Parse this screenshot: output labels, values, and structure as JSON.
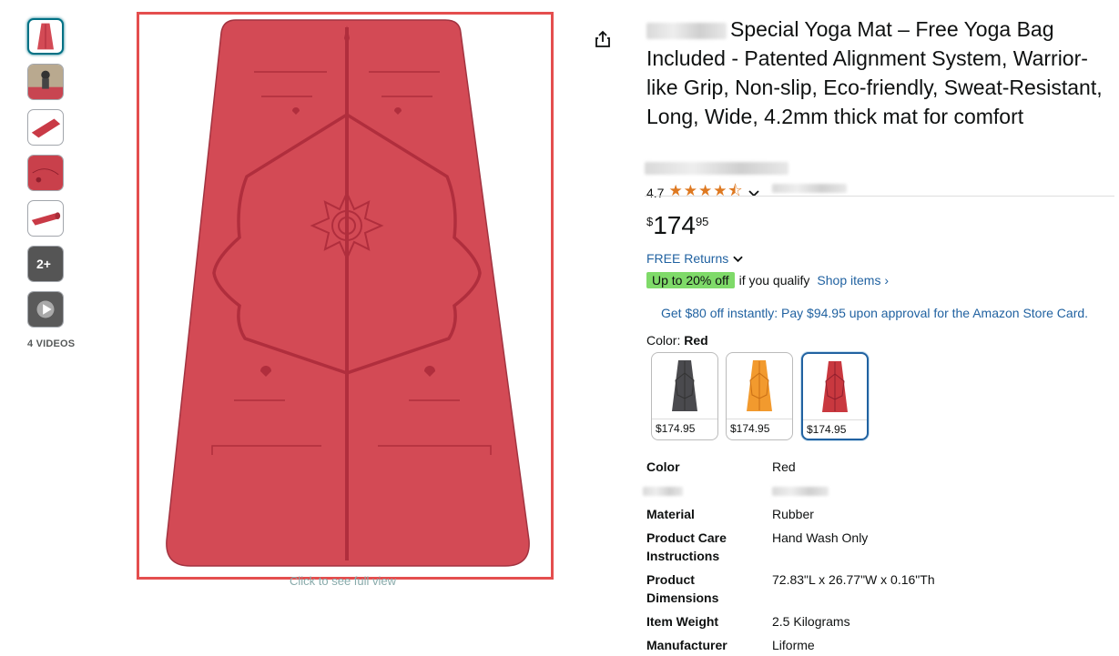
{
  "gallery": {
    "videos_label": "4 VIDEOS",
    "more_count": "2+",
    "full_view": "Click to see full view"
  },
  "product": {
    "title": "Special Yoga Mat – Free Yoga Bag Included - Patented Alignment System, Warrior-like Grip, Non-slip, Eco-friendly, Sweat-Resistant, Long, Wide, 4.2mm thick mat for comfort",
    "rating_value": "4.7",
    "rating_stars": 4.5,
    "price_symbol": "$",
    "price_whole": "174",
    "price_fraction": "95",
    "free_returns": "FREE Returns",
    "promo_badge": "Up to 20% off",
    "promo_text": "if you qualify",
    "promo_link": "Shop items ›",
    "card_offer": "Get $80 off instantly: Pay $94.95 upon approval for the Amazon Store Card.",
    "color_label": "Color:",
    "color_selected": "Red"
  },
  "swatches": [
    {
      "name": "black",
      "price": "$174.95",
      "color": "#4a4a4e"
    },
    {
      "name": "orange",
      "price": "$174.95",
      "color": "#f29a2e"
    },
    {
      "name": "red",
      "price": "$174.95",
      "color": "#c9383f"
    }
  ],
  "specs": [
    {
      "key": "Color",
      "value": "Red"
    },
    {
      "key": "Material",
      "value": "Rubber"
    },
    {
      "key": "Product Care Instructions",
      "value": "Hand Wash Only"
    },
    {
      "key": "Product Dimensions",
      "value": "72.83\"L x 26.77\"W x 0.16\"Th"
    },
    {
      "key": "Item Weight",
      "value": "2.5 Kilograms"
    },
    {
      "key": "Manufacturer",
      "value": "Liforme"
    }
  ],
  "colors": {
    "mat": "#d34a55",
    "mat_line": "#b02e3d",
    "link": "#2162a1",
    "star": "#de7921",
    "promo_badge": "#7fda69",
    "frame": "#e44e4e"
  }
}
